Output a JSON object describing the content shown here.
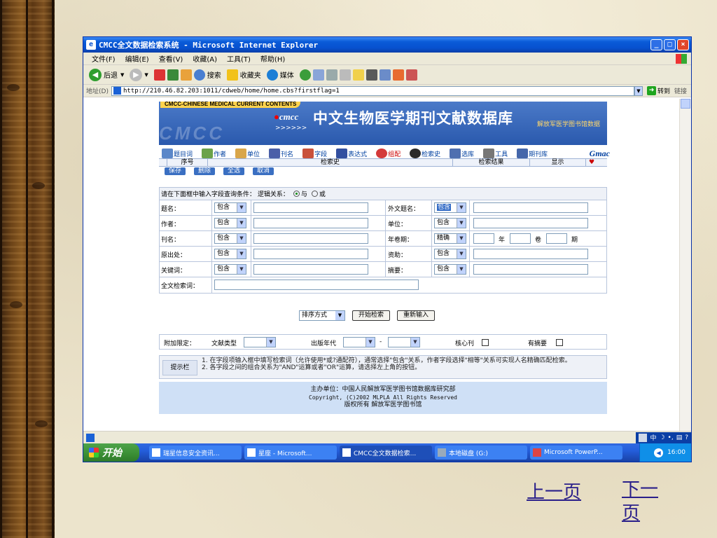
{
  "window": {
    "title": "CMCC全文数据检索系统 - Microsoft Internet Explorer",
    "menu": [
      "文件(F)",
      "编辑(E)",
      "查看(V)",
      "收藏(A)",
      "工具(T)",
      "帮助(H)"
    ],
    "toolbar": {
      "back": "后退",
      "search": "搜索",
      "favorites": "收藏夹",
      "media": "媒体"
    },
    "address_label": "地址(D)",
    "url": "http://210.46.82.203:1011/cdweb/home/home.cbs?firstflag=1",
    "goto": "转到",
    "links": "链接"
  },
  "banner": {
    "tag": "CMCC-CHINESE MEDICAL CURRENT CONTENTS",
    "watermark": "CMCC",
    "logo": "cmcc",
    "arrows": ">>>>>>",
    "title": "中文生物医学期刊文献数据库",
    "subtitle": "解放军医学图书馆数据"
  },
  "nav": [
    "题目词",
    "作者",
    "单位",
    "刊名",
    "字段",
    "表达式",
    "组配",
    "检索史",
    "选库",
    "工具",
    "期刊库"
  ],
  "nav_brand": "Gmac",
  "history": {
    "columns": [
      "序号",
      "检索史",
      "检索结果",
      "显示"
    ],
    "buttons": [
      "保存",
      "删除",
      "全选",
      "取消"
    ]
  },
  "form": {
    "header": "请在下面框中输入字段查询条件：  逻辑关系：",
    "logic": {
      "and": "与",
      "or": "或"
    },
    "rows": [
      {
        "left_label": "题名：",
        "left_op": "包含",
        "right_label": "外文题名：",
        "right_op": "包含"
      },
      {
        "left_label": "作者：",
        "left_op": "包含",
        "right_label": "单位：",
        "right_op": "包含"
      },
      {
        "left_label": "刊名：",
        "left_op": "包含",
        "right_label": "年卷期：",
        "right_op": "精确"
      },
      {
        "left_label": "原出处：",
        "left_op": "包含",
        "right_label": "资助：",
        "right_op": "包含"
      },
      {
        "left_label": "关键词：",
        "left_op": "包含",
        "right_label": "摘要：",
        "right_op": "包含"
      }
    ],
    "year": "年",
    "volume": "卷",
    "issue": "期",
    "fulltext_label": "全文检索词："
  },
  "actions": {
    "sort": "排序方式",
    "start": "开始检索",
    "reset": "重新输入"
  },
  "limits": {
    "label": "附加限定：",
    "doc_type": "文献类型",
    "pub_year": "出版年代",
    "dash": "-",
    "core": "核心刊",
    "abstract": "有摘要"
  },
  "tips": {
    "label": "提示栏",
    "line1": "1. 在字段项输入框中填写检索词（允许使用*或?通配符），通常选择\"包含\"关系，作者字段选择\"相等\"关系可实现人名精确匹配检索。",
    "line2": "2. 各字段之间的组合关系为\"AND\"运算或者\"OR\"运算，请选择左上角的按钮。"
  },
  "footer": {
    "line1": "主办单位：中国人民解放军医学图书馆数据库研究部",
    "line2": "Copyright, (C)2002 MLPLA All Rights Reserved",
    "line3": "版权所有  解放军医学图书馆"
  },
  "statusbar": {
    "ime": "中"
  },
  "taskbar": {
    "start": "开始",
    "tasks": [
      "瑞星信息安全资讯...",
      "星座 - Microsoft...",
      "CMCC全文数据检索...",
      "本地磁盘 (G:)",
      "Microsoft PowerP..."
    ],
    "clock": "16:00"
  },
  "slide_nav": {
    "prev": "上一页",
    "next": "下一页"
  },
  "colors": {
    "title_blue": "#0751cf",
    "banner_blue": "#2a59ad",
    "footer_blue": "#cfe0f6",
    "link_color": "#2a1f8a"
  }
}
